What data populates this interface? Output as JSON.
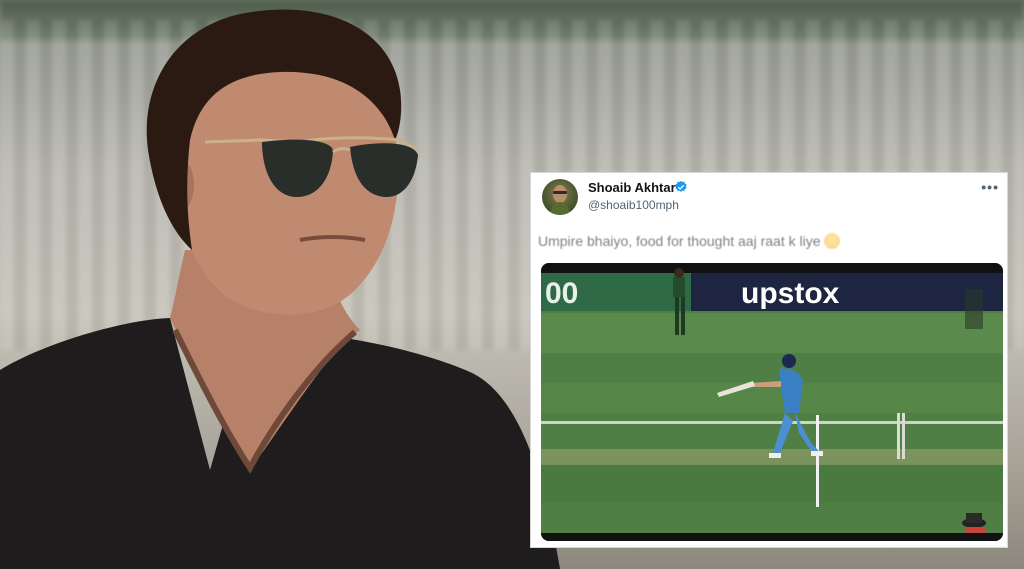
{
  "tweet": {
    "author_name": "Shoaib Akhtar",
    "author_handle": "@shoaib100mph",
    "text": "Umpire bhaiyo, food for thought aaj raat k liye",
    "more_icon": "more-horizontal-icon",
    "verified_icon": "verified-badge-icon",
    "verified_color": "#1d9bf0",
    "emoji_icon": "thinking-face-emoji"
  },
  "video": {
    "banner_text": "upstox",
    "partial_banner_text": "00"
  },
  "colors": {
    "pitch_green": "#4f7f45",
    "banner_navy": "#1d2540",
    "jersey_blue": "#3b7fc4"
  }
}
